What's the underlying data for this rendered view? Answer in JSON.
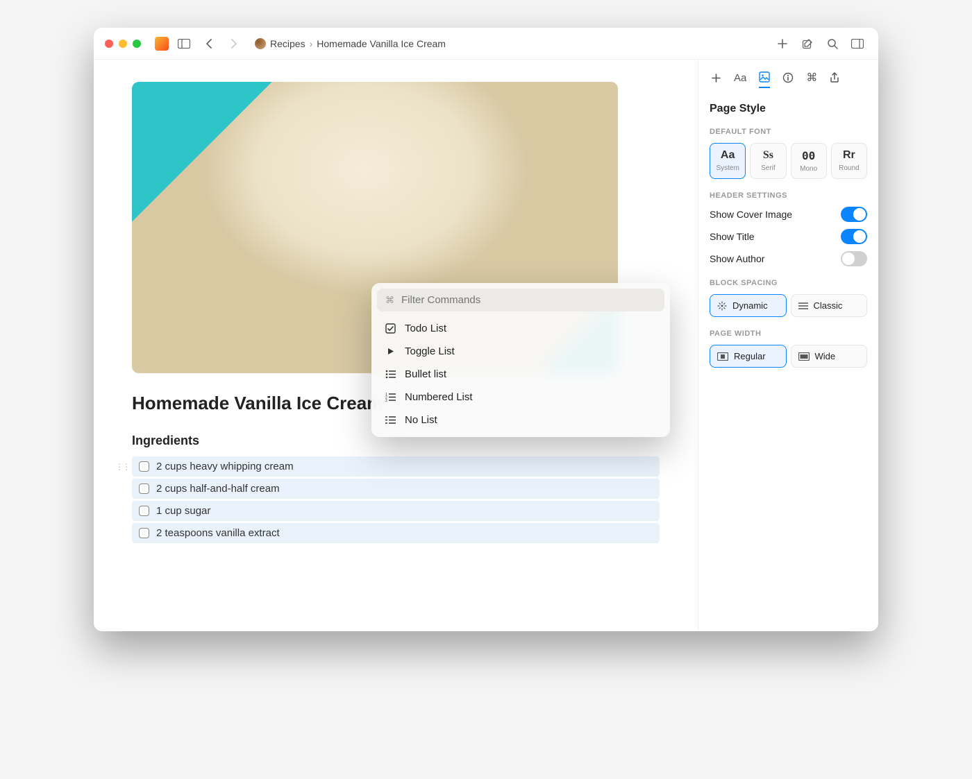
{
  "breadcrumb": {
    "parent": "Recipes",
    "current": "Homemade Vanilla Ice Cream"
  },
  "page": {
    "title": "Homemade Vanilla Ice Cream",
    "section_ingredients": "Ingredients",
    "ingredients": [
      "2 cups heavy whipping cream",
      "2 cups half-and-half cream",
      "1 cup sugar",
      "2 teaspoons vanilla extract"
    ]
  },
  "palette": {
    "placeholder": "Filter Commands",
    "items": [
      {
        "icon": "todo",
        "label": "Todo List"
      },
      {
        "icon": "toggle",
        "label": "Toggle List"
      },
      {
        "icon": "bullet",
        "label": "Bullet list"
      },
      {
        "icon": "numbered",
        "label": "Numbered List"
      },
      {
        "icon": "none",
        "label": "No List"
      }
    ]
  },
  "sidebar": {
    "title": "Page Style",
    "labels": {
      "default_font": "DEFAULT FONT",
      "header_settings": "HEADER SETTINGS",
      "block_spacing": "BLOCK SPACING",
      "page_width": "PAGE WIDTH"
    },
    "fonts": [
      {
        "glyph": "Aa",
        "label": "System",
        "active": true
      },
      {
        "glyph": "Ss",
        "label": "Serif",
        "active": false
      },
      {
        "glyph": "00",
        "label": "Mono",
        "active": false
      },
      {
        "glyph": "Rr",
        "label": "Round",
        "active": false
      }
    ],
    "header_settings": {
      "show_cover_image": {
        "label": "Show Cover Image",
        "on": true
      },
      "show_title": {
        "label": "Show Title",
        "on": true
      },
      "show_author": {
        "label": "Show Author",
        "on": false
      }
    },
    "block_spacing": [
      {
        "label": "Dynamic",
        "active": true
      },
      {
        "label": "Classic",
        "active": false
      }
    ],
    "page_width": [
      {
        "label": "Regular",
        "active": true
      },
      {
        "label": "Wide",
        "active": false
      }
    ]
  }
}
